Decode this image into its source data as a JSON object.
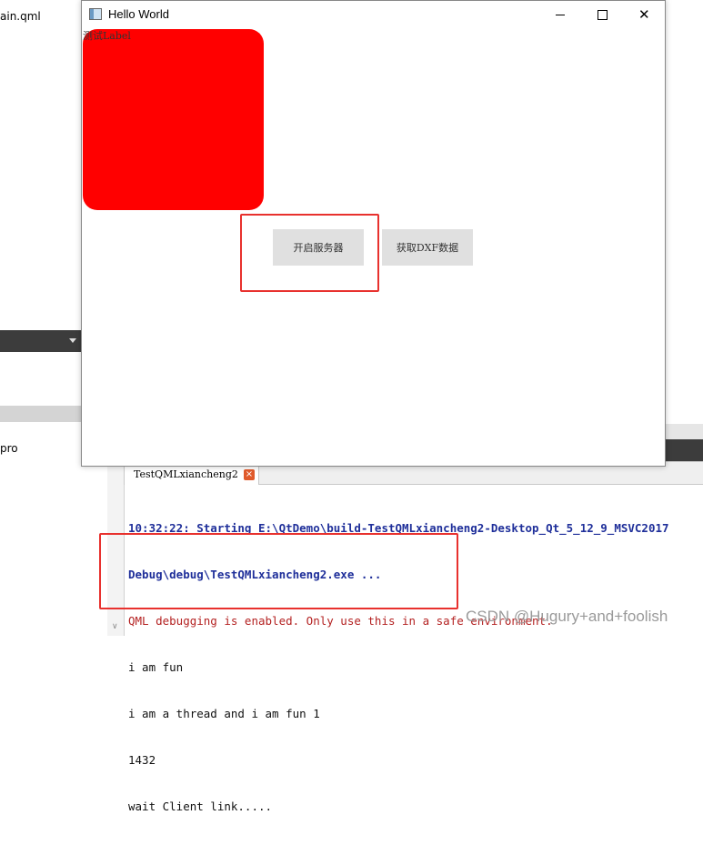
{
  "ide": {
    "file_name": "ain.qml",
    "project_label": "pro"
  },
  "output_pane": {
    "tab_label": "TestQMLxiancheng2",
    "close_glyph": "×",
    "scroll_glyph": "∨",
    "lines": [
      {
        "text": "10:32:22: Starting E:\\QtDemo\\build-TestQMLxiancheng2-Desktop_Qt_5_12_9_MSVC2017",
        "style": "bold"
      },
      {
        "text": "Debug\\debug\\TestQMLxiancheng2.exe ...",
        "style": "bold"
      },
      {
        "text": "QML debugging is enabled. Only use this in a safe environment.",
        "style": "red"
      },
      {
        "text": "i am fun",
        "style": "plain"
      },
      {
        "text": "i am a thread and i am fun 1",
        "style": "plain"
      },
      {
        "text": "1432",
        "style": "plain"
      },
      {
        "text": "wait Client link.....",
        "style": "plain"
      }
    ]
  },
  "window": {
    "title": "Hello World",
    "minimize_glyph": "",
    "close_glyph": "✕",
    "test_label": "测试Label",
    "start_server_button": "开启服务器",
    "get_dxf_button": "获取DXF数据",
    "rect_color": "#ff0000"
  },
  "watermark": "CSDN @Hugury+and+foolish",
  "colors": {
    "annotation": "#e8312e",
    "log_bold": "#1f2f9a",
    "log_red": "#b42222"
  }
}
